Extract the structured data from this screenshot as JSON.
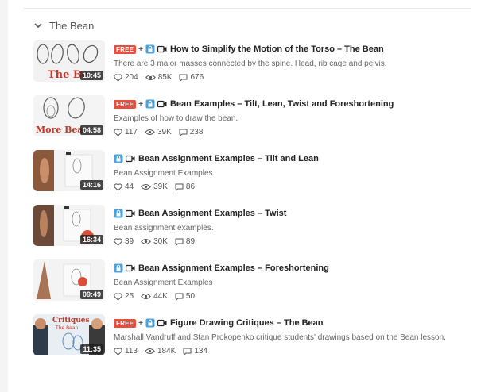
{
  "section": {
    "title": "The Bean"
  },
  "badges": {
    "free": "FREE",
    "plus": "+"
  },
  "lessons": [
    {
      "title": "How to Simplify the Motion of the Torso – The Bean",
      "description": "There are 3 major masses connected by the spine. Head, rib cage and pelvis.",
      "duration": "10:45",
      "likes": "204",
      "views": "85K",
      "comments": "676",
      "thumb_text": "The Be",
      "free": true
    },
    {
      "title": "Bean Examples – Tilt, Lean, Twist and Foreshortening",
      "description": "Examples of how to draw the bean.",
      "duration": "04:58",
      "likes": "117",
      "views": "39K",
      "comments": "238",
      "thumb_text": "More Bea",
      "free": true
    },
    {
      "title": "Bean Assignment Examples – Tilt and Lean",
      "description": "Bean Assignment Examples",
      "duration": "14:16",
      "likes": "44",
      "views": "39K",
      "comments": "86",
      "free": false
    },
    {
      "title": "Bean Assignment Examples – Twist",
      "description": "Bean assignment examples.",
      "duration": "16:34",
      "likes": "39",
      "views": "30K",
      "comments": "89",
      "free": false
    },
    {
      "title": "Bean Assignment Examples – Foreshortening",
      "description": "Bean Assignment Examples",
      "duration": "09:49",
      "likes": "25",
      "views": "44K",
      "comments": "50",
      "free": false
    },
    {
      "title": "Figure Drawing Critiques – The Bean",
      "description": "Marshall Vandruff and Stan Prokopenko critique students' drawings based on the Bean lesson.",
      "duration": "11:35",
      "likes": "113",
      "views": "184K",
      "comments": "134",
      "thumb_text_1": "Critiques",
      "thumb_text_2": "The Bean",
      "free": true
    }
  ],
  "colors": {
    "free_badge": "#e74c3c",
    "lock_icon": "#4aa3df",
    "text_dark": "#222222",
    "text_muted": "#666666"
  }
}
